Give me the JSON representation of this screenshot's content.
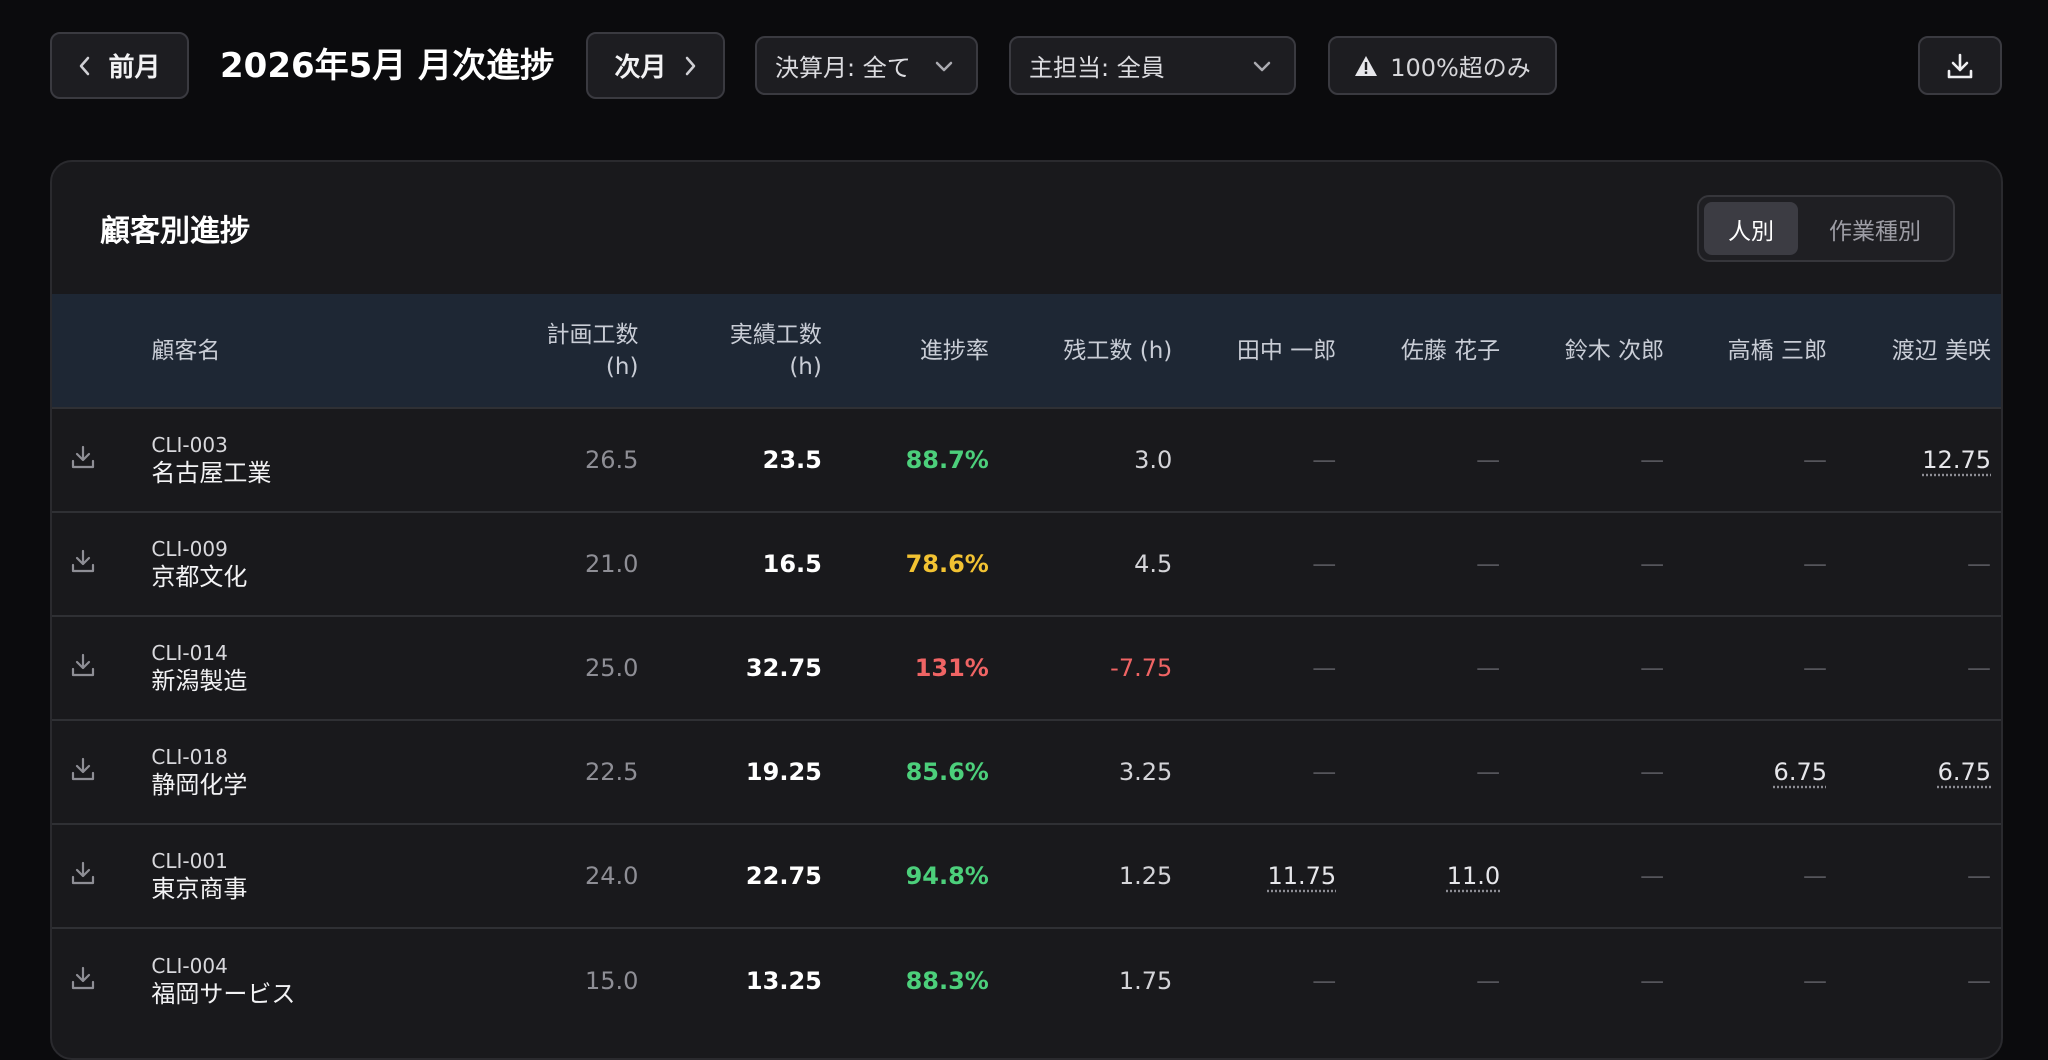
{
  "toolbar": {
    "prev_label": "前月",
    "title": "2026年5月 月次進捗",
    "next_label": "次月",
    "closing_filter": "決算月: 全て",
    "owner_filter": "主担当: 全員",
    "over_label": "100%超のみ"
  },
  "panel": {
    "title": "顧客別進捗",
    "view_person": "人別",
    "view_task": "作業種別"
  },
  "table": {
    "headers": {
      "name": "顧客名",
      "plan_1": "計画工数",
      "plan_2": "(h)",
      "actual_1": "実績工数",
      "actual_2": "(h)",
      "rate": "進捗率",
      "remain": "残工数 (h)",
      "p1": "田中 一郎",
      "p2": "佐藤 花子",
      "p3": "鈴木 次郎",
      "p4": "高橋 三郎",
      "p5": "渡辺 美咲"
    },
    "rows": [
      {
        "id": "CLI-003",
        "name": "名古屋工業",
        "plan": "26.5",
        "actual": "23.5",
        "rate": "88.7%",
        "rate_status": "green",
        "remain": "3.0",
        "p1": "—",
        "p2": "—",
        "p3": "—",
        "p4": "—",
        "p5": "12.75"
      },
      {
        "id": "CLI-009",
        "name": "京都文化",
        "plan": "21.0",
        "actual": "16.5",
        "rate": "78.6%",
        "rate_status": "yellow",
        "remain": "4.5",
        "p1": "—",
        "p2": "—",
        "p3": "—",
        "p4": "—",
        "p5": "—"
      },
      {
        "id": "CLI-014",
        "name": "新潟製造",
        "plan": "25.0",
        "actual": "32.75",
        "rate": "131%",
        "rate_status": "red",
        "remain": "-7.75",
        "p1": "—",
        "p2": "—",
        "p3": "—",
        "p4": "—",
        "p5": "—"
      },
      {
        "id": "CLI-018",
        "name": "静岡化学",
        "plan": "22.5",
        "actual": "19.25",
        "rate": "85.6%",
        "rate_status": "green",
        "remain": "3.25",
        "p1": "—",
        "p2": "—",
        "p3": "—",
        "p4": "6.75",
        "p5": "6.75"
      },
      {
        "id": "CLI-001",
        "name": "東京商事",
        "plan": "24.0",
        "actual": "22.75",
        "rate": "94.8%",
        "rate_status": "green",
        "remain": "1.25",
        "p1": "11.75",
        "p2": "11.0",
        "p3": "—",
        "p4": "—",
        "p5": "—"
      },
      {
        "id": "CLI-004",
        "name": "福岡サービス",
        "plan": "15.0",
        "actual": "13.25",
        "rate": "88.3%",
        "rate_status": "green",
        "remain": "1.75",
        "p1": "—",
        "p2": "—",
        "p3": "—",
        "p4": "—",
        "p5": "—"
      }
    ]
  },
  "icons": {
    "prev": "chevron-left-icon",
    "next": "chevron-right-icon",
    "dropdown": "chevron-down-icon",
    "warning": "warning-icon",
    "export": "download-icon",
    "row_download": "download-icon"
  },
  "colors": {
    "background": "#0b0b0d",
    "panel": "#19191c",
    "header_row": "#1e2734",
    "rate_green": "#4ccf7b",
    "rate_yellow": "#f2c232",
    "rate_red": "#ef6464"
  }
}
